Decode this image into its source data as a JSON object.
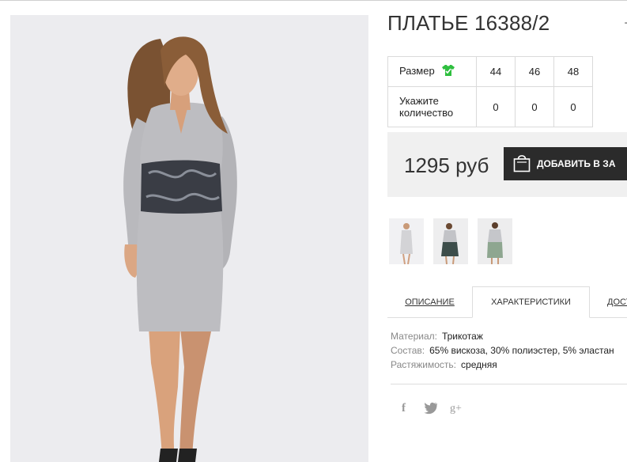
{
  "product": {
    "title": "ПЛАТЬЕ 16388/2",
    "price": "1295 руб"
  },
  "sizes_table": {
    "size_label": "Размер",
    "quantity_label_1": "Укажите",
    "quantity_label_2": "количество",
    "sizes": [
      "44",
      "46",
      "48"
    ],
    "quantities": [
      "0",
      "0",
      "0"
    ]
  },
  "cart": {
    "label": "ДОБАВИТЬ В ЗА"
  },
  "tabs": [
    {
      "label": "ОПИСАНИЕ"
    },
    {
      "label": "ХАРАКТЕРИСТИКИ"
    },
    {
      "label": "ДОСТ"
    }
  ],
  "specs": [
    {
      "key": "Материал:",
      "value": "Трикотаж"
    },
    {
      "key": "Состав:",
      "value": "65% вискоза, 30% полиэстер, 5% эластан"
    },
    {
      "key": "Растяжимость:",
      "value": "средняя"
    }
  ],
  "social": {
    "facebook": "f",
    "googleplus": "g+"
  },
  "colors": {
    "accent_dark": "#2b2b2b",
    "size_icon_green": "#2fbf3f"
  }
}
